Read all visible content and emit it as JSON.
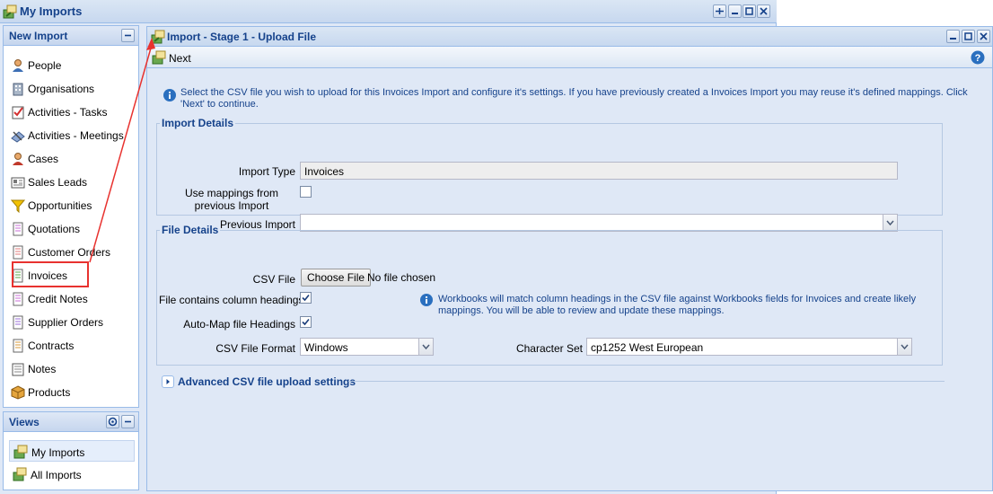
{
  "outer_window": {
    "title": "My Imports"
  },
  "left_panel": {
    "header": "New Import",
    "items": [
      {
        "label": "People",
        "icon": "person-icon"
      },
      {
        "label": "Organisations",
        "icon": "building-icon"
      },
      {
        "label": "Activities - Tasks",
        "icon": "task-icon"
      },
      {
        "label": "Activities - Meetings",
        "icon": "meeting-icon"
      },
      {
        "label": "Cases",
        "icon": "case-icon"
      },
      {
        "label": "Sales Leads",
        "icon": "sales-leads-icon"
      },
      {
        "label": "Opportunities",
        "icon": "funnel-icon"
      },
      {
        "label": "Quotations",
        "icon": "quotation-icon"
      },
      {
        "label": "Customer Orders",
        "icon": "customer-order-icon"
      },
      {
        "label": "Invoices",
        "icon": "invoice-icon"
      },
      {
        "label": "Credit Notes",
        "icon": "credit-note-icon"
      },
      {
        "label": "Supplier Orders",
        "icon": "supplier-order-icon"
      },
      {
        "label": "Contracts",
        "icon": "contract-icon"
      },
      {
        "label": "Notes",
        "icon": "note-icon"
      },
      {
        "label": "Products",
        "icon": "product-box-icon"
      }
    ]
  },
  "views_panel": {
    "header": "Views",
    "items": [
      {
        "label": "My Imports",
        "selected": true
      },
      {
        "label": "All Imports",
        "selected": false
      }
    ]
  },
  "import_window": {
    "title": "Import - Stage 1 - Upload File",
    "toolbar": {
      "next_label": "Next"
    },
    "intro_text": "Select the CSV file you wish to upload for this Invoices Import and configure it's settings. If you have previously created a Invoices Import you may reuse it's defined mappings. Click 'Next' to continue.",
    "import_details": {
      "legend": "Import Details",
      "import_type_label": "Import Type",
      "import_type_value": "Invoices",
      "use_mappings_label": "Use mappings from previous Import",
      "use_mappings_checked": false,
      "previous_import_label": "Previous Import",
      "previous_import_value": ""
    },
    "file_details": {
      "legend": "File Details",
      "csv_file_label": "CSV File",
      "choose_file_label": "Choose File",
      "no_file_text": "No file chosen",
      "column_headings_label": "File contains column headings",
      "column_headings_checked": true,
      "auto_map_label": "Auto-Map file Headings",
      "auto_map_checked": true,
      "format_label": "CSV File Format",
      "format_value": "Windows",
      "charset_label": "Character Set",
      "charset_value": "cp1252 West European",
      "info_text": "Workbooks will match column headings in the CSV file against Workbooks fields for Invoices and create likely mappings. You will be able to review and update these mappings."
    },
    "advanced_label": "Advanced CSV file upload settings"
  },
  "colors": {
    "header_text": "#15428b",
    "panel_background": "#dfe8f6",
    "border": "#99bbe8",
    "annotation_red": "#e8322f"
  }
}
